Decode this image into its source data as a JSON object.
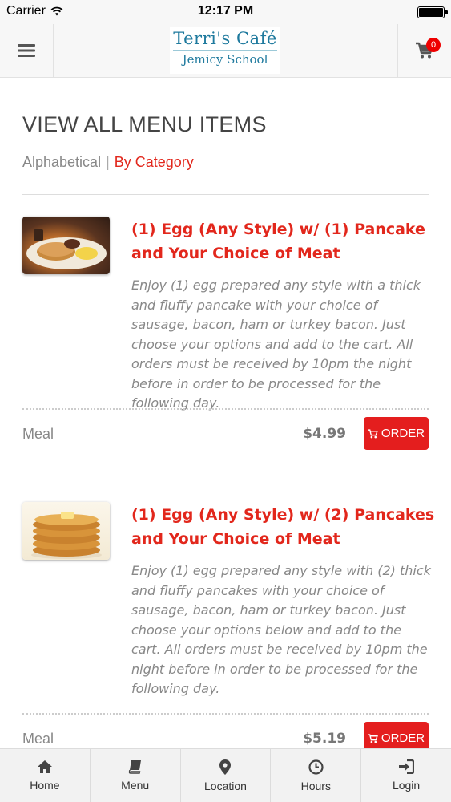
{
  "status_bar": {
    "carrier": "Carrier",
    "time": "12:17 PM"
  },
  "header": {
    "logo_line1": "Terri's Café",
    "logo_line2": "Jemicy School",
    "cart_count": "0",
    "menu_icon": "hamburger-icon",
    "cart_icon": "cart-icon"
  },
  "page": {
    "title": "VIEW ALL MENU ITEMS",
    "sort_alphabetical": "Alphabetical",
    "sort_separator": "|",
    "sort_by_category": "By Category"
  },
  "items": [
    {
      "title": "(1) Egg (Any Style) w/ (1) Pancake and Your Choice of Meat",
      "description": "Enjoy (1) egg prepared any style with a thick and fluffy pancake with your choice of sausage, bacon, ham or turkey bacon. Just choose your options and add to the cart. All orders must be received by 10pm the night before in order to be processed for the following day.",
      "type": "Meal",
      "price": "$4.99",
      "order_label": "ORDER"
    },
    {
      "title": "(1) Egg (Any Style) w/ (2) Pancakes and Your Choice of Meat",
      "description": "Enjoy (1) egg prepared any style with (2) thick and fluffy pancakes with your choice of sausage, bacon, ham or turkey bacon. Just choose your options below and add to the cart. All orders must be received by 10pm the night before in order to be processed for the following day.",
      "type": "Meal",
      "price": "$5.19",
      "order_label": "ORDER"
    }
  ],
  "bottom_nav": [
    {
      "label": "Home",
      "icon": "home-icon"
    },
    {
      "label": "Menu",
      "icon": "book-icon"
    },
    {
      "label": "Location",
      "icon": "map-pin-icon"
    },
    {
      "label": "Hours",
      "icon": "clock-icon"
    },
    {
      "label": "Login",
      "icon": "sign-in-icon"
    }
  ],
  "colors": {
    "accent": "#e2271c",
    "order_button": "#e41e1e",
    "logo": "#1f7a9e"
  }
}
